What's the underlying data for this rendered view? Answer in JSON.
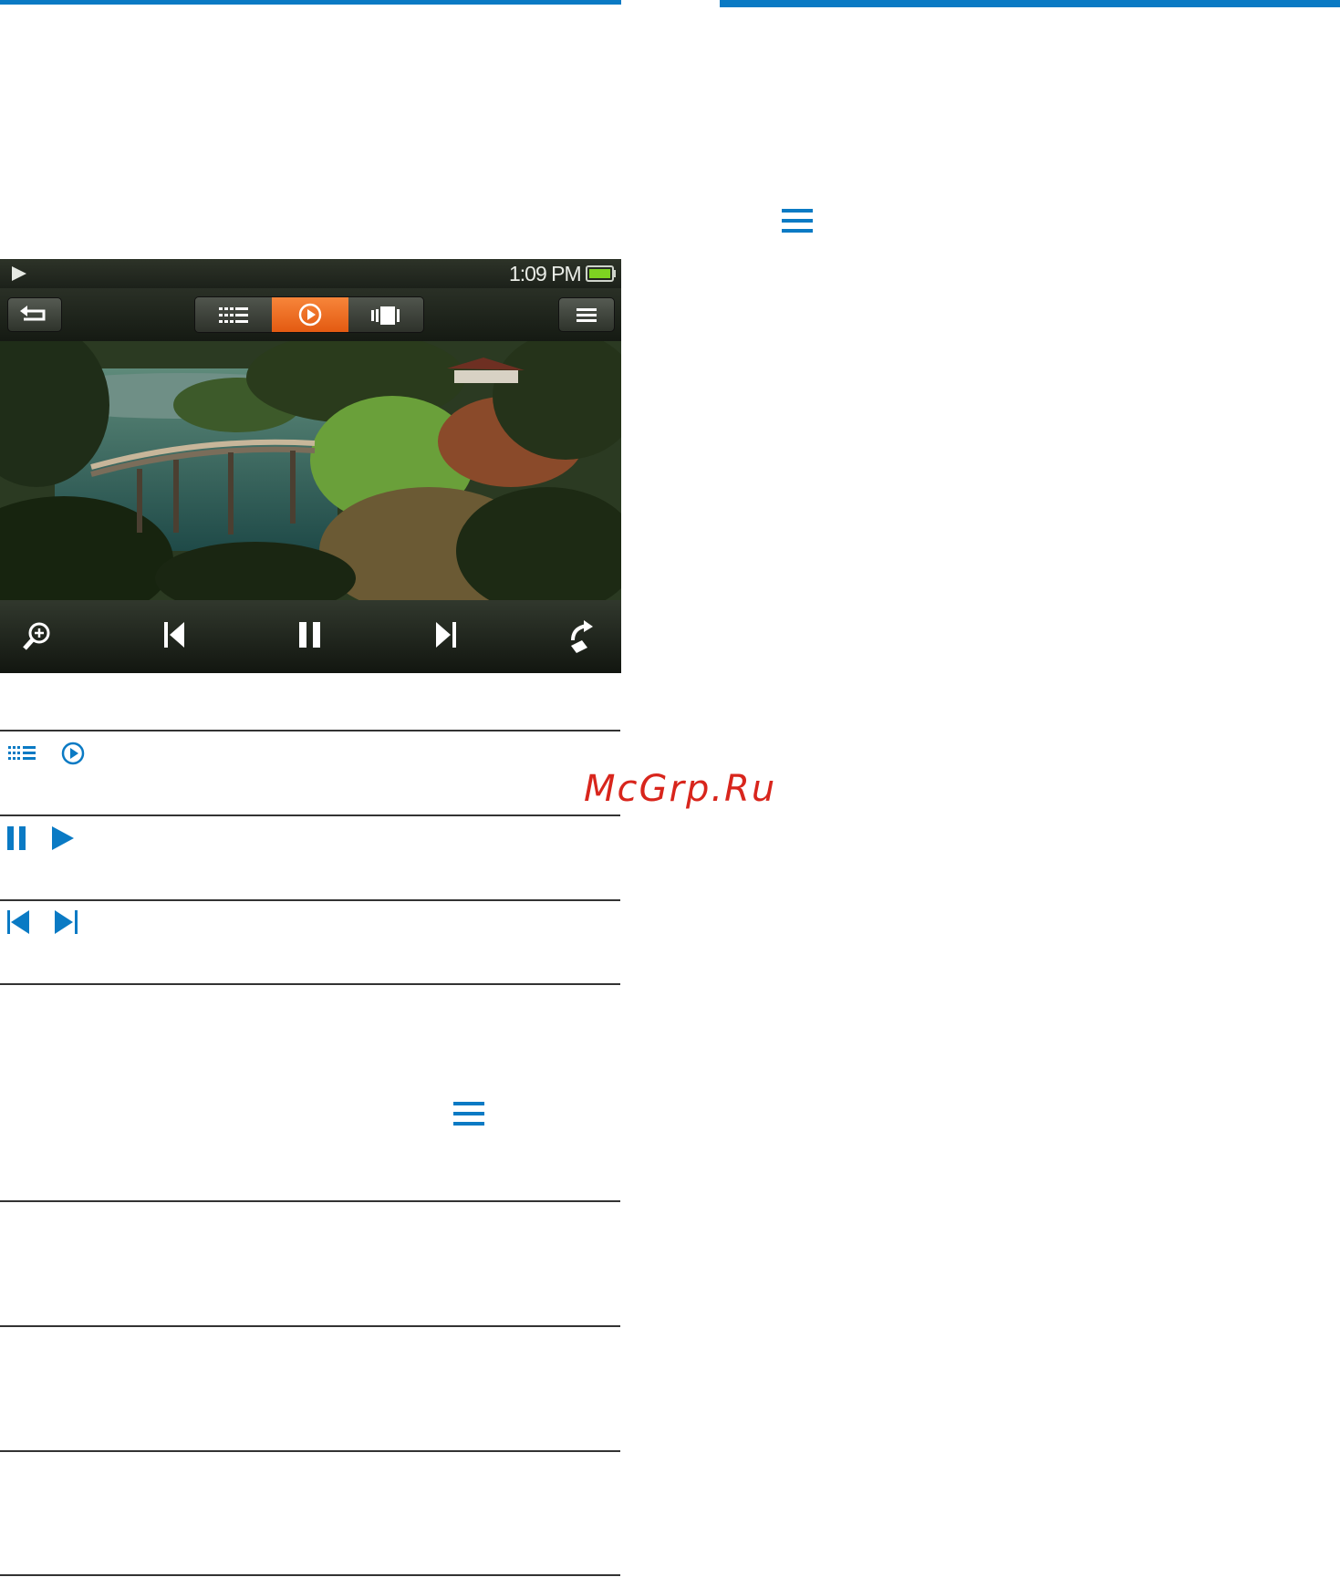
{
  "device": {
    "status_time": "1:09 PM",
    "battery_level": 1.0,
    "accent_color": "#f26a1b",
    "icons": [
      "play-icon",
      "battery-icon",
      "back-icon",
      "list-view-icon",
      "play-circle-icon",
      "filmstrip-icon",
      "menu-icon",
      "zoom-in-icon",
      "previous-icon",
      "pause-icon",
      "next-icon",
      "rotate-icon"
    ]
  },
  "watermark": {
    "text": "McGrp.Ru"
  },
  "colors": {
    "brand_blue": "#0a7ac4",
    "watermark_red": "#d8251c"
  }
}
